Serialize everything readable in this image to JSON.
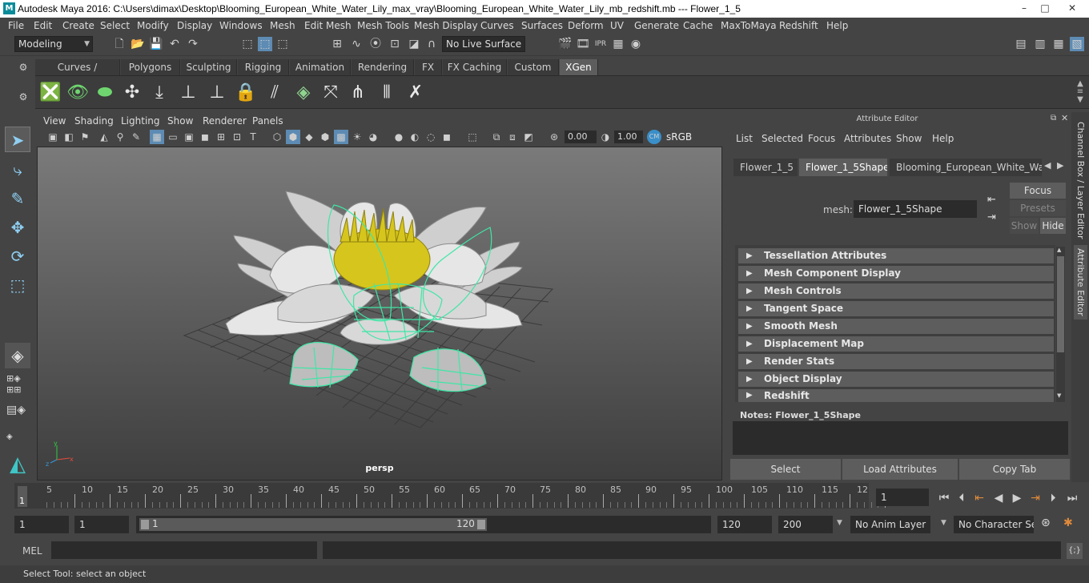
{
  "window": {
    "title": "Autodesk Maya 2016: C:\\Users\\dimax\\Desktop\\Blooming_European_White_Water_Lily_max_vray\\Blooming_European_White_Water_Lily_mb_redshift.mb   ---   Flower_1_5",
    "minimize": "–",
    "maximize": "□",
    "close": "✕"
  },
  "menus": [
    "File",
    "Edit",
    "Create",
    "Select",
    "Modify",
    "Display",
    "Windows",
    "Mesh",
    "Edit Mesh",
    "Mesh Tools",
    "Mesh Display",
    "Curves",
    "Surfaces",
    "Deform",
    "UV",
    "Generate",
    "Cache",
    "MaxToMaya",
    "Redshift",
    "Help"
  ],
  "status": {
    "mode": "Modeling",
    "live_surface": "No Live Surface"
  },
  "shelf_tabs": [
    "Curves / Surfaces",
    "Polygons",
    "Sculpting",
    "Rigging",
    "Animation",
    "Rendering",
    "FX",
    "FX Caching",
    "Custom",
    "XGen"
  ],
  "viewport": {
    "menus": [
      "View",
      "Shading",
      "Lighting",
      "Show",
      "Renderer",
      "Panels"
    ],
    "exposure": "0.00",
    "gamma": "1.00",
    "colorspace": "sRGB gamma",
    "camera": "persp"
  },
  "attr_editor": {
    "title": "Attribute Editor",
    "menus": [
      "List",
      "Selected",
      "Focus",
      "Attributes",
      "Show",
      "Help"
    ],
    "tabs": [
      "Flower_1_5",
      "Flower_1_5Shape",
      "Blooming_European_White_Water_"
    ],
    "mesh_label": "mesh:",
    "mesh_value": "Flower_1_5Shape",
    "focus": "Focus",
    "presets": "Presets",
    "show": "Show",
    "hide": "Hide",
    "sections": [
      "Tessellation Attributes",
      "Mesh Component Display",
      "Mesh Controls",
      "Tangent Space",
      "Smooth Mesh",
      "Displacement Map",
      "Render Stats",
      "Object Display",
      "Redshift"
    ],
    "notes": "Notes:  Flower_1_5Shape",
    "buttons": {
      "select": "Select",
      "load": "Load Attributes",
      "copy": "Copy Tab"
    }
  },
  "side_tabs": [
    "Channel Box / Layer Editor",
    "Attribute Editor"
  ],
  "timeline": {
    "ticks": [
      "5",
      "10",
      "15",
      "20",
      "25",
      "30",
      "35",
      "40",
      "45",
      "50",
      "55",
      "60",
      "65",
      "70",
      "75",
      "80",
      "85",
      "90",
      "95",
      "100",
      "105",
      "110",
      "115",
      "12"
    ],
    "current": "1",
    "frame_field": "1"
  },
  "range": {
    "start": "1",
    "playback_start": "1",
    "slider_start": "1",
    "slider_end": "120",
    "playback_end": "120",
    "end": "200",
    "anim_layer": "No Anim Layer",
    "char_set": "No Character Set"
  },
  "command": {
    "label": "MEL"
  },
  "help": "Select Tool: select an object"
}
